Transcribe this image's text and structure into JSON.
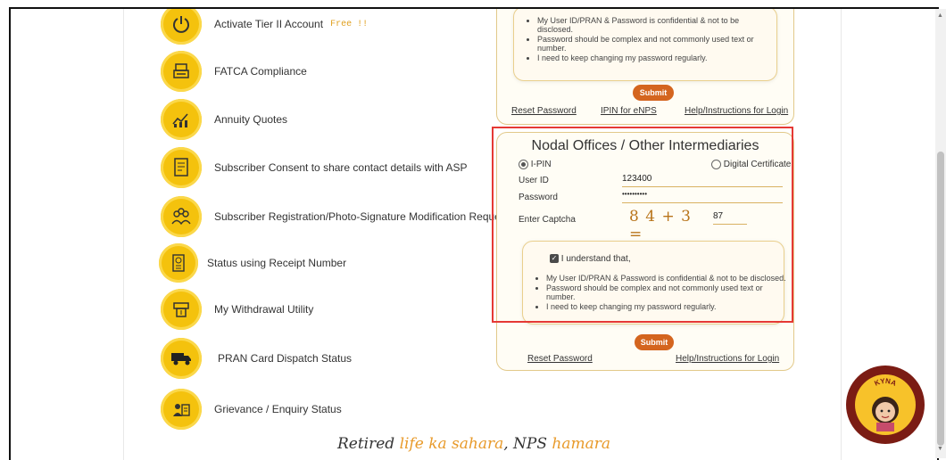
{
  "menu": [
    {
      "label": "Activate Tier II Account",
      "badge": "Free !!",
      "icon": "power-icon"
    },
    {
      "label": "FATCA Compliance",
      "icon": "printer-icon"
    },
    {
      "label": "Annuity Quotes",
      "icon": "chart-icon"
    },
    {
      "label": "Subscriber Consent to share contact details with ASP",
      "icon": "document-icon"
    },
    {
      "label": "Subscriber Registration/Photo-Signature Modification Request",
      "icon": "group-icon"
    },
    {
      "label": "Status using Receipt Number",
      "icon": "receipt-icon"
    },
    {
      "label": "My Withdrawal Utility",
      "icon": "withdrawal-icon"
    },
    {
      "label": "PRAN Card Dispatch Status",
      "icon": "truck-icon"
    },
    {
      "label": "Grievance / Enquiry Status",
      "icon": "enquiry-icon"
    }
  ],
  "top_panel": {
    "notes": [
      "My User ID/PRAN & Password is confidential & not to be disclosed.",
      "Password should be complex and not commonly used text or number.",
      "I need to keep changing my password regularly."
    ],
    "submit": "Submit",
    "links": [
      "Reset Password",
      "IPIN for eNPS",
      "Help/Instructions for Login"
    ]
  },
  "nodal": {
    "title": "Nodal Offices / Other Intermediaries",
    "options": [
      "I-PIN",
      "Digital Certificate"
    ],
    "selected_option": "I-PIN",
    "user_id_label": "User ID",
    "user_id_value": "123400",
    "password_label": "Password",
    "password_value": "••••••••••",
    "captcha_label": "Enter Captcha",
    "captcha_text": "8 4 + 3 =",
    "captcha_answer": "87",
    "understand": "I understand that,",
    "notes": [
      "My User ID/PRAN & Password is confidential & not to be disclosed.",
      "Password should be complex and not commonly used text or number.",
      "I need to keep changing my password regularly."
    ],
    "submit": "Submit",
    "links": [
      "Reset Password",
      "Help/Instructions for Login"
    ]
  },
  "tagline": {
    "part1": "Retired ",
    "part2": "life ka sahara",
    "part3": ", NPS ",
    "part4": "hamara"
  },
  "chatbot": {
    "name": "KYNA"
  },
  "colors": {
    "accent": "#d4651f",
    "icon_bg": "#f4c20d",
    "highlight_border": "#e53935"
  }
}
